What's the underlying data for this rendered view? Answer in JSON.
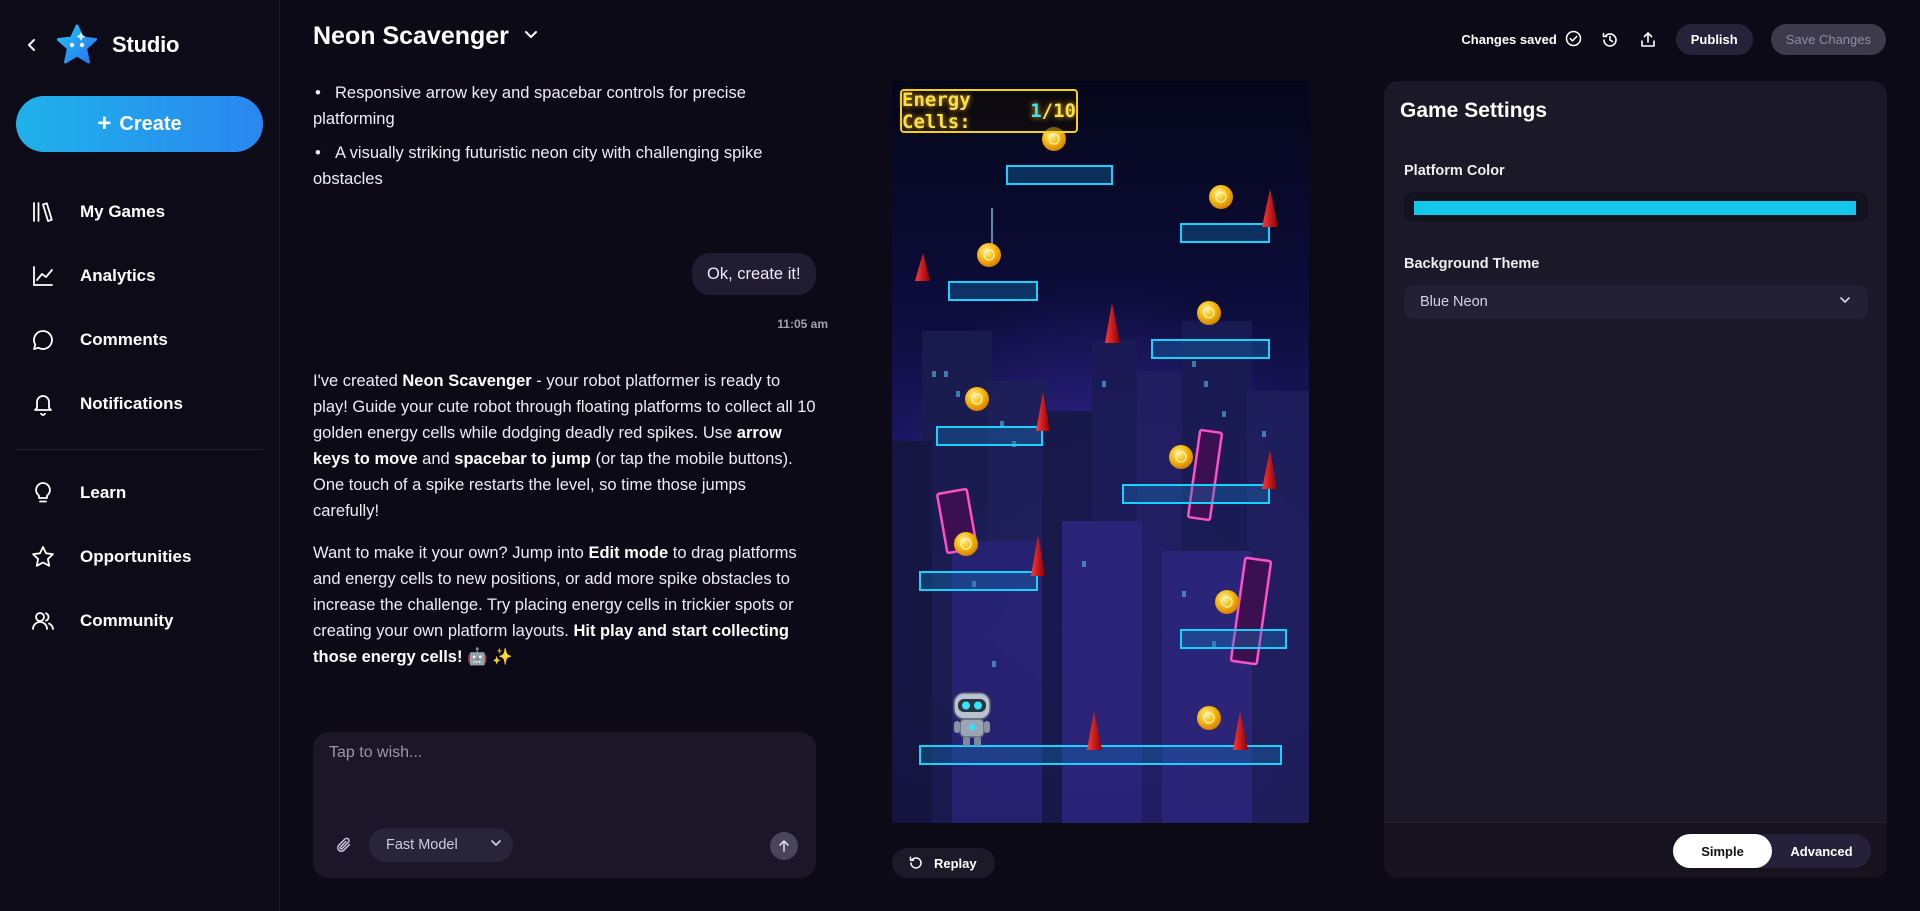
{
  "app": {
    "brand": "Studio",
    "create_label": "Create"
  },
  "sidebar": {
    "items": [
      {
        "label": "My Games",
        "icon": "library-icon"
      },
      {
        "label": "Analytics",
        "icon": "chart-line-icon"
      },
      {
        "label": "Comments",
        "icon": "chat-bubble-icon"
      },
      {
        "label": "Notifications",
        "icon": "bell-icon"
      },
      {
        "label": "Learn",
        "icon": "lightbulb-icon"
      },
      {
        "label": "Opportunities",
        "icon": "star-icon"
      },
      {
        "label": "Community",
        "icon": "users-icon"
      }
    ]
  },
  "header": {
    "title": "Neon Scavenger",
    "status": "Changes saved",
    "publish_label": "Publish",
    "save_label": "Save Changes"
  },
  "chat": {
    "bullets": [
      "Responsive arrow key and spacebar controls for precise platforming",
      "A visually striking futuristic neon city with challenging spike obstacles"
    ],
    "user_message": "Ok, create it!",
    "user_time": "11:05 am",
    "reply": {
      "p1_a": "I've created ",
      "p1_b": "Neon Scavenger",
      "p1_c": " - your robot platformer is ready to play! Guide your cute robot through floating platforms to collect all 10 golden energy cells while dodging deadly red spikes. Use ",
      "p1_d": "arrow keys to move",
      "p1_e": " and ",
      "p1_f": "spacebar to jump",
      "p1_g": " (or tap the mobile buttons). One touch of a spike restarts the level, so time those jumps carefully!",
      "p2_a": "Want to make it your own? Jump into ",
      "p2_b": "Edit mode",
      "p2_c": " to drag platforms and energy cells to new positions, or add more spike obstacles to increase the challenge. Try placing energy cells in trickier spots or creating your own platform layouts. ",
      "p2_d": "Hit play and start collecting those energy cells!",
      "p2_e": " 🤖 ✨"
    },
    "input_placeholder": "Tap to wish...",
    "model": "Fast Model"
  },
  "game": {
    "score_label": "Energy Cells: ",
    "score_collected": "1",
    "score_sep": "/",
    "score_total": "10",
    "replay_label": "Replay"
  },
  "settings": {
    "title": "Game Settings",
    "platform_color_label": "Platform Color",
    "platform_color": "#11c8ea",
    "background_theme_label": "Background Theme",
    "background_theme": "Blue Neon",
    "mode_simple": "Simple",
    "mode_advanced": "Advanced"
  }
}
